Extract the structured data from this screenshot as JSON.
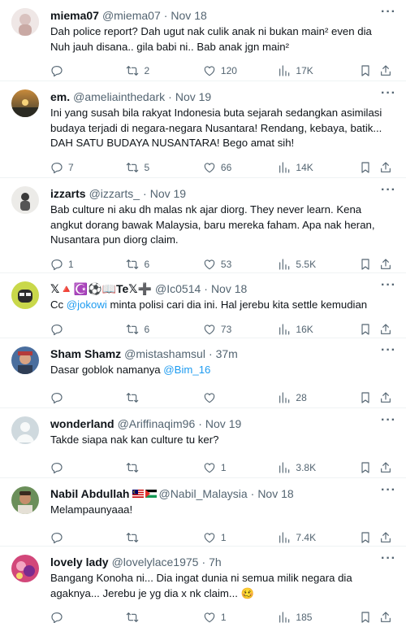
{
  "tweets": [
    {
      "name": "miema07",
      "handle": "@miema07",
      "time": "Nov 18",
      "text": "Dah police report? Dah ugut nak culik anak ni bukan main² even dia Nuh jauh disana.. gila babi ni.. Bab anak jgn main²",
      "replies": "",
      "retweets": "2",
      "likes": "120",
      "views": "17K"
    },
    {
      "name": "em.",
      "handle": "@ameliainthedark",
      "time": "Nov 19",
      "text": "Ini yang susah bila rakyat Indonesia buta sejarah sedangkan asimilasi budaya terjadi di negara-negara Nusantara! Rendang, kebaya, batik... DAH SATU BUDAYA NUSANTARA! Bego amat sih!",
      "replies": "7",
      "retweets": "5",
      "likes": "66",
      "views": "14K"
    },
    {
      "name": "izzarts",
      "handle": "@izzarts_",
      "time": "Nov 19",
      "text": "Bab culture ni aku dh malas nk ajar diorg. They never learn. Kena angkut dorang bawak Malaysia, baru mereka faham. Apa nak heran, Nusantara pun diorg claim.",
      "replies": "1",
      "retweets": "6",
      "likes": "53",
      "views": "5.5K"
    },
    {
      "name": "𝕏🔺☪️⚽📖Te𝕏➕",
      "handle": "@Ic0514",
      "time": "Nov 18",
      "text_before": "Cc ",
      "mention": "@jokowi",
      "text_after": " minta polisi cari dia ini. Hal jerebu kita settle kemudian",
      "replies": "",
      "retweets": "6",
      "likes": "73",
      "views": "16K"
    },
    {
      "name": "Sham Shamz",
      "handle": "@mistashamsul",
      "time": "37m",
      "text_before": "Dasar goblok namanya ",
      "mention": "@Bim_16",
      "text_after": "",
      "replies": "",
      "retweets": "",
      "likes": "",
      "views": "28"
    },
    {
      "name": "wonderland",
      "handle": "@Ariffinaqim96",
      "time": "Nov 19",
      "text": "Takde siapa nak kan culture tu ker?",
      "replies": "",
      "retweets": "",
      "likes": "1",
      "views": "3.8K"
    },
    {
      "name": "Nabil Abdullah",
      "handle": "@Nabil_Malaysia",
      "time": "Nov 18",
      "text": "Melampaunyaaa!",
      "replies": "",
      "retweets": "",
      "likes": "1",
      "views": "7.4K"
    },
    {
      "name": "lovely lady",
      "handle": "@lovelylace1975",
      "time": "7h",
      "text": "Bangang Konoha ni... Dia ingat dunia ni semua milik negara dia agaknya... Jerebu je yg dia x nk claim... 🥴",
      "replies": "",
      "retweets": "",
      "likes": "1",
      "views": "185"
    }
  ],
  "dot": "·",
  "more": "···",
  "icons": [
    "reply-icon",
    "retweet-icon",
    "like-icon",
    "views-icon",
    "bookmark-icon",
    "share-icon"
  ],
  "colors": {
    "link": "#1d9bf0",
    "secondary": "#536471",
    "text": "#0f1419",
    "divider": "#eff3f4"
  }
}
